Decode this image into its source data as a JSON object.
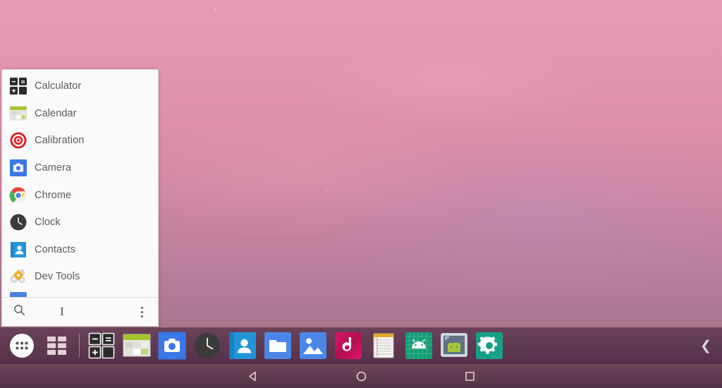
{
  "wallpaper": {
    "gradient_top": "#e79bb2",
    "gradient_bottom": "#98657c",
    "name": "pink-purple-gradient-wallpaper"
  },
  "app_drawer": {
    "panel_background": "#fafafa",
    "apps": [
      {
        "label": "Calculator",
        "icon": "calculator-icon"
      },
      {
        "label": "Calendar",
        "icon": "calendar-icon"
      },
      {
        "label": "Calibration",
        "icon": "calibration-target-icon"
      },
      {
        "label": "Camera",
        "icon": "camera-icon"
      },
      {
        "label": "Chrome",
        "icon": "chrome-icon"
      },
      {
        "label": "Clock",
        "icon": "clock-icon"
      },
      {
        "label": "Contacts",
        "icon": "contacts-icon"
      },
      {
        "label": "Dev Tools",
        "icon": "dev-tools-icon"
      },
      {
        "label": "",
        "icon": "partial-app-icon"
      }
    ],
    "search": {
      "placeholder": "",
      "value": "",
      "caret": "I",
      "search_icon": "search-icon",
      "overflow_icon": "overflow-menu-icon"
    }
  },
  "taskbar": {
    "background": "#613b51",
    "items": [
      {
        "name": "app-drawer-button",
        "icon": "apps-dots-circle-icon",
        "label": "Apps"
      },
      {
        "name": "all-apps-grid-button",
        "icon": "grid-squares-icon",
        "label": "Grid"
      },
      {
        "name": "taskbar-divider",
        "icon": "divider",
        "label": ""
      },
      {
        "name": "taskbar-calculator",
        "icon": "calculator-icon",
        "label": "Calculator"
      },
      {
        "name": "taskbar-calendar",
        "icon": "calendar-icon",
        "label": "Calendar"
      },
      {
        "name": "taskbar-camera",
        "icon": "camera-icon",
        "label": "Camera"
      },
      {
        "name": "taskbar-clock",
        "icon": "clock-icon",
        "label": "Clock"
      },
      {
        "name": "taskbar-contacts",
        "icon": "contacts-icon",
        "label": "Contacts"
      },
      {
        "name": "taskbar-files",
        "icon": "folder-icon",
        "label": "Files"
      },
      {
        "name": "taskbar-gallery",
        "icon": "gallery-image-icon",
        "label": "Gallery"
      },
      {
        "name": "taskbar-music",
        "icon": "music-note-icon",
        "label": "Music"
      },
      {
        "name": "taskbar-notes",
        "icon": "notepad-icon",
        "label": "Notes"
      },
      {
        "name": "taskbar-terminal",
        "icon": "android-grid-icon",
        "label": "Terminal"
      },
      {
        "name": "taskbar-remote-android",
        "icon": "android-screen-icon",
        "label": "Android"
      },
      {
        "name": "taskbar-settings",
        "icon": "settings-gear-icon",
        "label": "Settings"
      }
    ],
    "collapse": {
      "icon": "chevron-left-icon",
      "glyph": "❮"
    }
  },
  "navbar": {
    "back": {
      "icon": "back-triangle-icon"
    },
    "home": {
      "icon": "home-circle-icon"
    },
    "recents": {
      "icon": "recents-square-icon"
    }
  }
}
